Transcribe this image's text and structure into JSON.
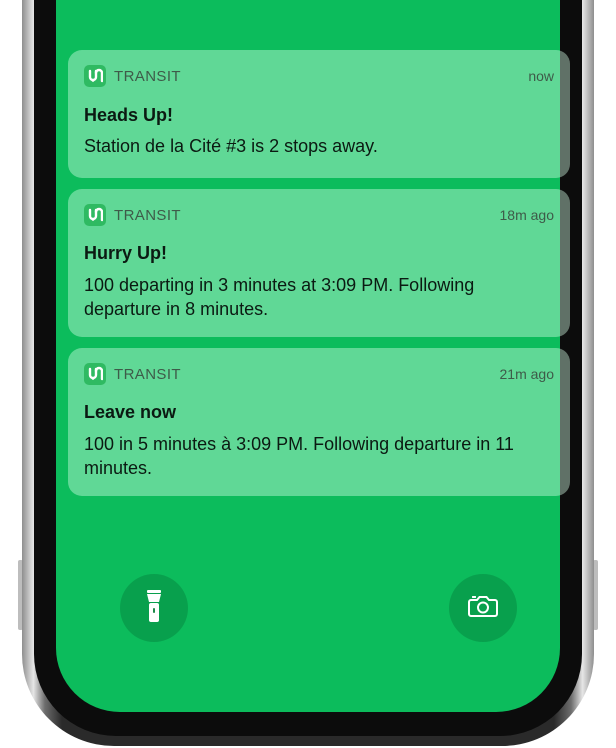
{
  "colors": {
    "screen_bg": "#0cbc5c",
    "app_icon": "#2fba62"
  },
  "notifications": [
    {
      "app": "TRANSIT",
      "time": "now",
      "title": "Heads Up!",
      "body": "Station de la Cité #3 is 2 stops away."
    },
    {
      "app": "TRANSIT",
      "time": "18m ago",
      "title": "Hurry Up!",
      "body": "100 departing in 3 minutes at 3:09 PM. Following departure in 8 minutes."
    },
    {
      "app": "TRANSIT",
      "time": "21m ago",
      "title": "Leave now",
      "body": "100 in 5 minutes à 3:09 PM. Following departure in 11 minutes."
    }
  ],
  "quick_actions": {
    "left_icon": "flashlight-icon",
    "right_icon": "camera-icon"
  }
}
